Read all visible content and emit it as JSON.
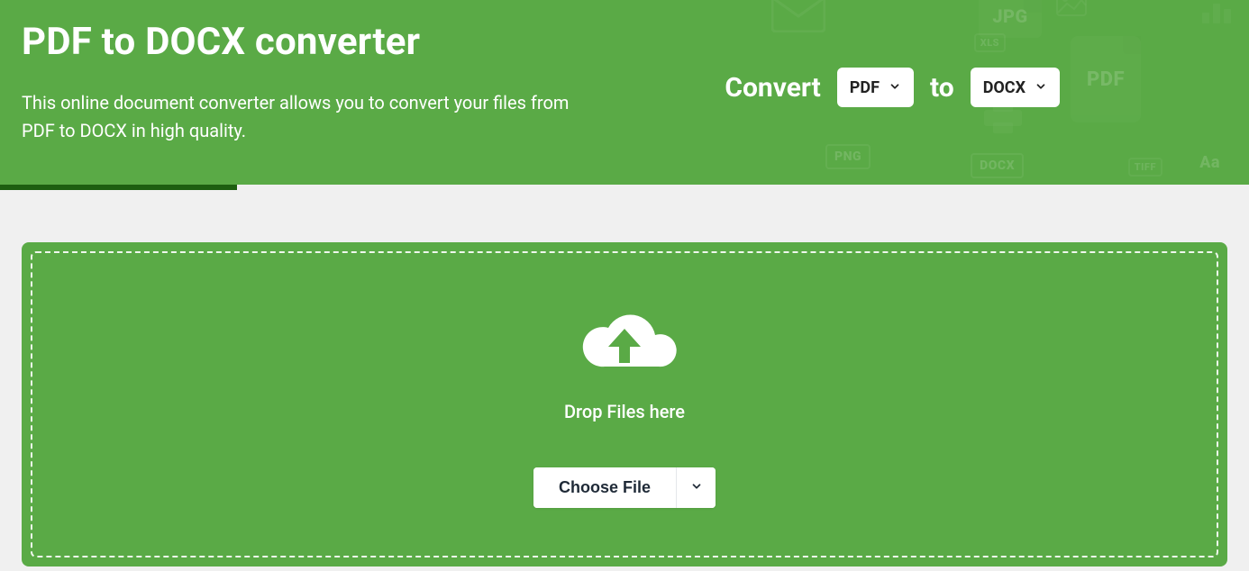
{
  "colors": {
    "primary_green": "#5aaa46",
    "dark_green": "#1d5f10",
    "page_bg": "#f0f0f0",
    "white": "#ffffff"
  },
  "hero": {
    "title": "PDF to DOCX converter",
    "subtitle": "This online document converter allows you to convert your files from PDF to DOCX in high quality.",
    "decor_labels": {
      "pdf": "PDF",
      "jpg": "JPG",
      "png": "PNG",
      "xls": "XLS",
      "docx": "DOCX",
      "tiff": "TIFF",
      "aa": "Aa"
    }
  },
  "convert": {
    "verb": "Convert",
    "from_selected": "PDF",
    "to_label": "to",
    "to_selected": "DOCX"
  },
  "dropzone": {
    "drop_label": "Drop Files here",
    "choose_label": "Choose File"
  }
}
